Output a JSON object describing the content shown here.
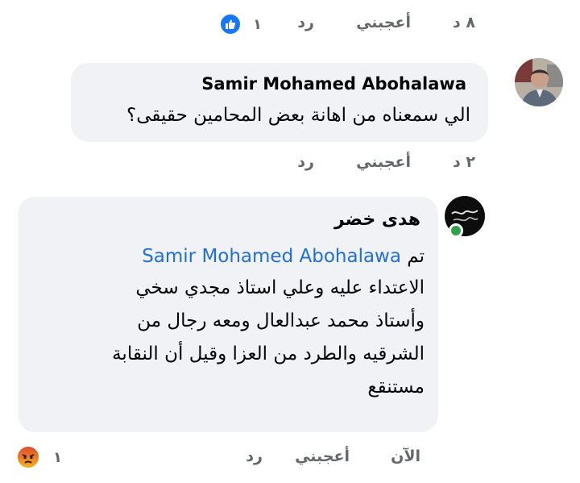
{
  "top_actions": {
    "time": "٨ د",
    "like": "أعجبني",
    "reply": "رد",
    "reaction_count": "١"
  },
  "comment1": {
    "author": "Samir Mohamed Abohalawa",
    "text": "الي سمعناه من اهانة بعض المحامين حقيقى؟",
    "time": "٢ د",
    "like": "أعجبني",
    "reply": "رد"
  },
  "comment2": {
    "author": "هدى خضر",
    "prefix": "تم",
    "mention": "Samir Mohamed Abohalawa",
    "lines": [
      "الاعتداء عليه وعلي استاذ مجدي سخي",
      "وأستاذ محمد عبدالعال ومعه رجال من",
      "الشرقيه والطرد من العزا وقيل أن النقابة",
      "مستنقع"
    ],
    "time": "الآن",
    "like": "أعجبني",
    "reply": "رد",
    "reaction_count": "١"
  },
  "colors": {
    "bubble": "#f0f2f5",
    "meta": "#65676b",
    "mention": "#216fdb",
    "like_blue": "#1877f2",
    "angry": "#e9710f"
  }
}
